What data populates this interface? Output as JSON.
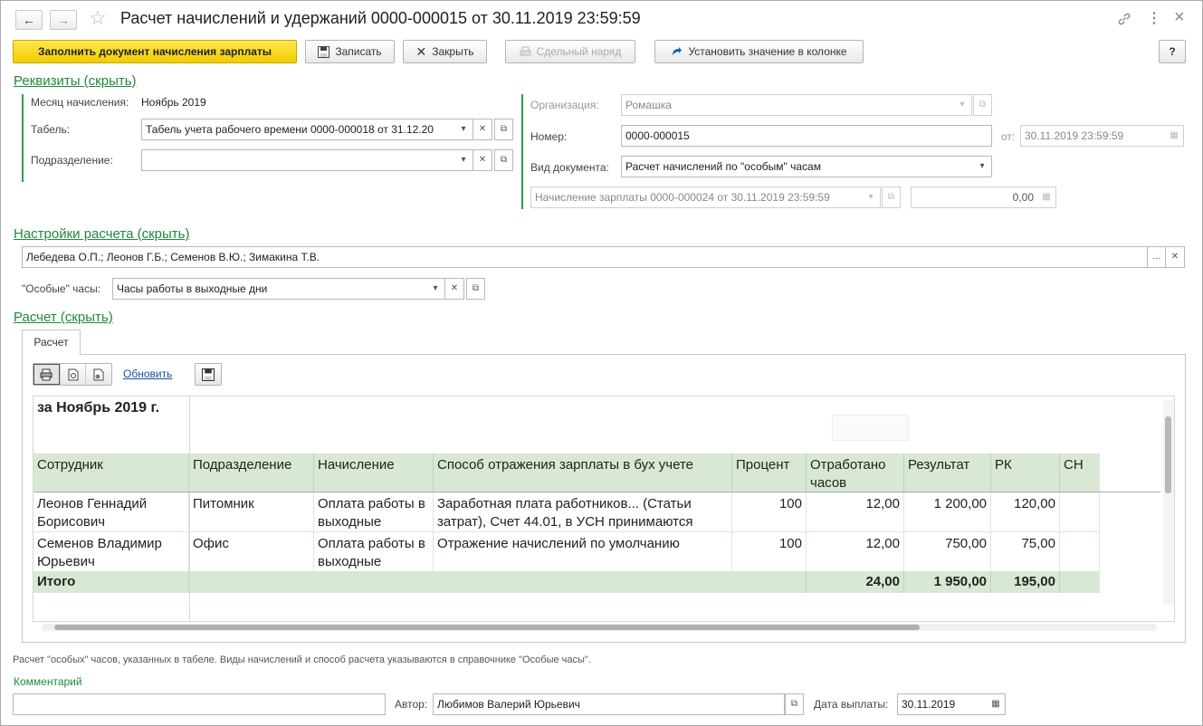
{
  "window": {
    "title": "Расчет начислений и удержаний 0000-000015 от 30.11.2019 23:59:59",
    "back_icon": "←",
    "forward_icon": "→",
    "star_icon": "☆",
    "link_icon": "🔗",
    "more_icon": "⋮",
    "close_icon": "×"
  },
  "toolbar": {
    "fill_label": "Заполнить документ начисления зарплаты",
    "save_label": "Записать",
    "close_label": "Закрыть",
    "piecework_label": "Сдельный наряд",
    "set_value_label": "Установить значение в колонке",
    "help_label": "?"
  },
  "requisites": {
    "section_title": "Реквизиты (скрыть)",
    "month_label": "Месяц начисления:",
    "month_value": "Ноябрь 2019",
    "timesheet_label": "Табель:",
    "timesheet_value": "Табель учета рабочего времени 0000-000018 от 31.12.20",
    "department_label": "Подразделение:",
    "department_value": "",
    "org_label": "Организация:",
    "org_value": "Ромашка",
    "number_label": "Номер:",
    "number_value": "0000-000015",
    "date_label": "от:",
    "date_value": "30.11.2019 23:59:59",
    "doc_type_label": "Вид документа:",
    "doc_type_value": "Расчет начислений по \"особым\" часам",
    "accrual_value": "Начисление зарплаты 0000-000024 от 30.11.2019 23:59:59",
    "amount_value": "0,00"
  },
  "settings": {
    "section_title": "Настройки расчета (скрыть)",
    "employees_value": "Лебедева О.П.; Леонов Г.Б.; Семенов В.Ю.; Зимакина Т.В.",
    "special_hours_label": "\"Особые\" часы:",
    "special_hours_value": "Часы работы в выходные дни"
  },
  "calculation": {
    "section_title": "Расчет (скрыть)",
    "tab_label": "Расчет",
    "refresh_label": "Обновить",
    "report_heading": "за Ноябрь 2019 г.",
    "columns": [
      "Сотрудник",
      "Подразделение",
      "Начисление",
      "Способ отражения зарплаты в бух учете",
      "Процент",
      "Отработано часов",
      "Результат",
      "РК",
      "СН"
    ],
    "rows": [
      {
        "employee": "Леонов Геннадий Борисович",
        "department": "Питомник",
        "accrual": "Оплата работы в выходные",
        "method": "Заработная плата работников... (Статьи затрат), Счет 44.01, в УСН принимаются",
        "percent": "100",
        "hours": "12,00",
        "result": "1 200,00",
        "rk": "120,00",
        "sn": ""
      },
      {
        "employee": "Семенов Владимир Юрьевич",
        "department": "Офис",
        "accrual": "Оплата работы в выходные",
        "method": "Отражение начислений по умолчанию",
        "percent": "100",
        "hours": "12,00",
        "result": "750,00",
        "rk": "75,00",
        "sn": ""
      }
    ],
    "total": {
      "label": "Итого",
      "hours": "24,00",
      "result": "1 950,00",
      "rk": "195,00"
    }
  },
  "footer": {
    "note": "Расчет \"особых\" часов, указанных  в табеле. Виды начислений и способ расчета указываются в справочнике \"Особые часы\".",
    "comment_label": "Комментарий",
    "comment_value": "",
    "author_label": "Автор:",
    "author_value": "Любимов Валерий Юрьевич",
    "pay_date_label": "Дата выплаты:",
    "pay_date_value": "30.11.2019"
  }
}
